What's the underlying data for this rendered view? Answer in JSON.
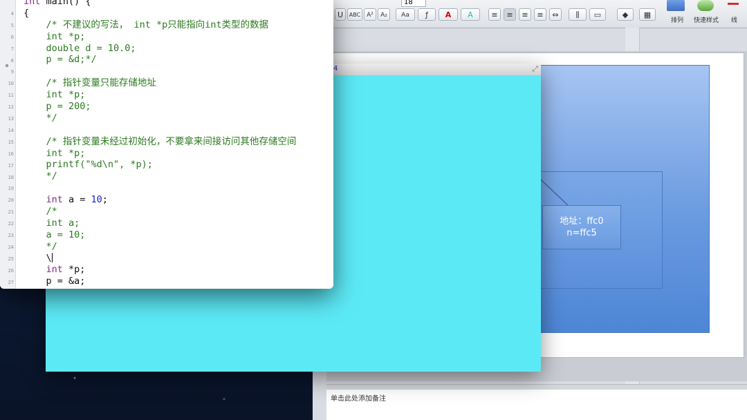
{
  "word": {
    "ribbon": {
      "font_size": "18",
      "buttons": [
        "U",
        "ABC",
        "A²",
        "A₂",
        "Aa",
        "A",
        "A"
      ],
      "arrange_label": "排列",
      "quick_styles_label": "快速样式",
      "line_label": "线"
    },
    "slide": {
      "address_line1": "地址：ffc0",
      "address_line2": "n=ffc5"
    },
    "notes_placeholder": "单击此处添加备注"
  },
  "cyan_window": {
    "title_number": "4"
  },
  "editor": {
    "line_numbers": [
      "",
      "4",
      "5",
      "6",
      "7",
      "8",
      "9",
      "10",
      "11",
      "12",
      "13",
      "14",
      "15",
      "16",
      "17",
      "18",
      "19",
      "20",
      "21",
      "22",
      "23",
      "24",
      "25",
      "26",
      "27"
    ],
    "lines": [
      "int main() {",
      "{",
      "    /* 不建议的写法， int *p只能指向int类型的数据",
      "    int *p;",
      "    double d = 10.0;",
      "    p = &d;*/",
      "",
      "    /* 指针变量只能存储地址",
      "    int *p;",
      "    p = 200;",
      "    */",
      "",
      "    /* 指针变量未经过初始化，不要拿来间接访问其他存储空间",
      "    int *p;",
      "    printf(\"%d\\n\", *p);",
      "    */",
      "",
      "    int a = 10;",
      "    /*",
      "    int a;",
      "    a = 10;",
      "    */",
      "    \\",
      "    int *p;",
      "    p = &a;"
    ]
  },
  "colors": {
    "comment": "#2b7a1e",
    "keyword": "#7b2a82",
    "number": "#1c21c2",
    "cyan": "#5ce9f6",
    "slide_blue": "#6b9be0"
  }
}
